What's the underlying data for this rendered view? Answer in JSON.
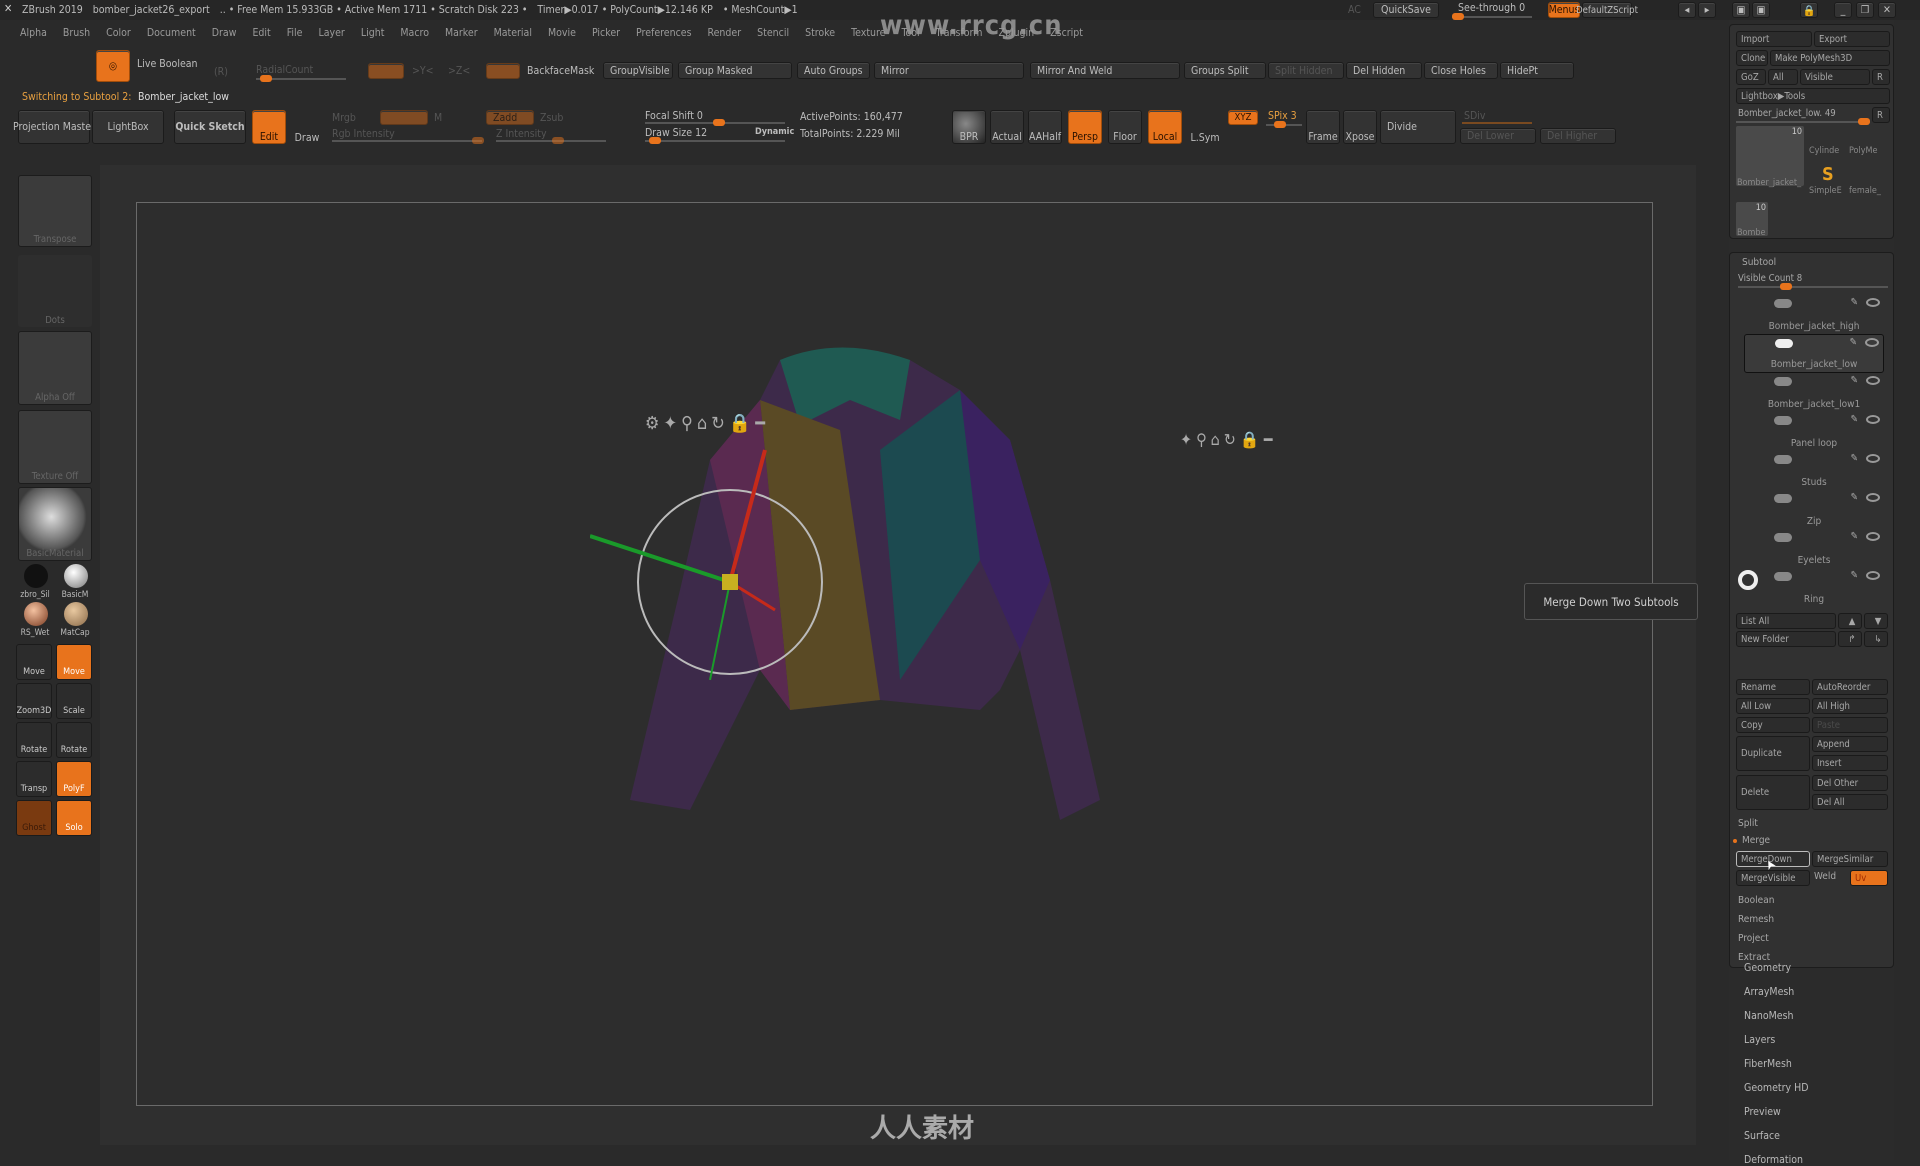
{
  "title_bar": {
    "items": [
      "ZBrush 2019",
      "bomber_jacket26_export",
      ".. • Free Mem 15.933GB • Active Mem 1711 • Scratch Disk 223 •",
      "Timer▶0.017 • PolyCount▶12.146 KP",
      "• MeshCount▶1"
    ],
    "ac": "AC",
    "quicksave": "QuickSave",
    "see_through": "See-through  0",
    "see_through_value": 0,
    "menus": "Menus",
    "default_zscript": "DefaultZScript"
  },
  "watermark": "www.rrcg.cn",
  "bottom_logo": "人人素材",
  "menu_bar": [
    "Alpha",
    "Brush",
    "Color",
    "Document",
    "Draw",
    "Edit",
    "File",
    "Layer",
    "Light",
    "Macro",
    "Marker",
    "Material",
    "Movie",
    "Picker",
    "Preferences",
    "Render",
    "Stencil",
    "Stroke",
    "Texture",
    "Tool",
    "Transform",
    "Zplugin",
    "Zscript"
  ],
  "toolbar": {
    "live_boolean": "Live Boolean",
    "r": "(R)",
    "radial_count": "RadialCount",
    "y": ">Y<",
    "z": ">Z<",
    "backface_mask": "BackfaceMask",
    "group_visible": "GroupVisible",
    "group_masked": "Group Masked",
    "auto_groups": "Auto Groups",
    "mirror": "Mirror",
    "mirror_and_weld": "Mirror And Weld",
    "groups_split": "Groups Split",
    "split_hidden": "Split Hidden",
    "del_hidden": "Del Hidden",
    "close_holes": "Close Holes",
    "hide_pt": "HidePt",
    "status_prefix": "Switching to Subtool 2:",
    "status_value": "Bomber_jacket_low",
    "projection_master": "Projection Master",
    "lightbox": "LightBox",
    "quick_sketch": "Quick Sketch",
    "edit": "Edit",
    "draw": "Draw",
    "mrgb": "Mrgb",
    "m": "M",
    "zadd": "Zadd",
    "zsub": "Zsub",
    "rgb_intensity": "Rgb Intensity",
    "z_intensity": "Z Intensity",
    "focal_shift": "Focal Shift 0",
    "draw_size": "Draw Size 12",
    "dynamic": "Dynamic",
    "active_points": "ActivePoints: 160,477",
    "total_points": "TotalPoints: 2.229 Mil",
    "bpr": "BPR",
    "actual": "Actual",
    "aahalf": "AAHalf",
    "persp": "Persp",
    "floor": "Floor",
    "local": "Local",
    "lsym": "L.Sym",
    "xyz": "XYZ",
    "spix": "SPix 3",
    "frame": "Frame",
    "xpose": "Xpose",
    "divide": "Divide",
    "sdiv": "SDiv",
    "del_lower": "Del Lower",
    "del_higher": "Del Higher"
  },
  "left_shelf": {
    "transpose": "Transpose",
    "dots": "Dots",
    "alpha": "Alpha Off",
    "texture": "Texture Off",
    "material": "BasicMaterial",
    "mats": [
      "zbro_Sil",
      "BasicM",
      "RS_Wet",
      "MatCap"
    ],
    "tools": [
      "Move",
      "Move",
      "Zoom3D",
      "Scale",
      "Rotate",
      "Rotate",
      "Transp",
      "PolyF",
      "Ghost",
      "Solo"
    ]
  },
  "right_panel": {
    "import": "Import",
    "export": "Export",
    "clone": "Clone",
    "make_polymesh": "Make PolyMesh3D",
    "goz": "GoZ",
    "all": "All",
    "visible": "Visible",
    "r": "R",
    "lightbox_tools": "Lightbox▶Tools",
    "current_tool": "Bomber_jacket_low. 49",
    "thumbs": [
      {
        "label": "Bomber_jacket_",
        "count": "10"
      },
      {
        "label": "Cylinde"
      },
      {
        "label": "PolyMe"
      },
      {
        "label": "SimpleE"
      },
      {
        "label": "female_"
      },
      {
        "label": "Bombe",
        "count": "10"
      }
    ],
    "subtool_title": "Subtool",
    "visible_count": "Visible Count 8",
    "subtools": [
      "Bomber_jacket_high",
      "Bomber_jacket_low",
      "Bomber_jacket_low1",
      "Panel loop",
      "Studs",
      "Zip",
      "Eyelets",
      "Ring"
    ],
    "selected_subtool": 1,
    "list_all": "List All",
    "new_folder": "New Folder",
    "rename": "Rename",
    "auto_reorder": "AutoReorder",
    "all_low": "All Low",
    "all_high": "All High",
    "copy": "Copy",
    "paste": "Paste",
    "duplicate": "Duplicate",
    "append": "Append",
    "insert": "Insert",
    "delete": "Delete",
    "del_other": "Del Other",
    "del_all": "Del All",
    "split": "Split",
    "merge": "Merge",
    "merge_down": "MergeDown",
    "merge_similar": "MergeSimilar",
    "merge_visible": "MergeVisible",
    "weld": "Weld",
    "uv": "Uv",
    "subsections": [
      "Boolean",
      "Remesh",
      "Project",
      "Extract"
    ],
    "menus": [
      "Geometry",
      "ArrayMesh",
      "NanoMesh",
      "Layers",
      "FiberMesh",
      "Geometry HD",
      "Preview",
      "Surface",
      "Deformation"
    ]
  },
  "tooltip": "Merge Down Two Subtools",
  "colors": {
    "accent": "#e8731c",
    "background": "#2a2a2a"
  }
}
